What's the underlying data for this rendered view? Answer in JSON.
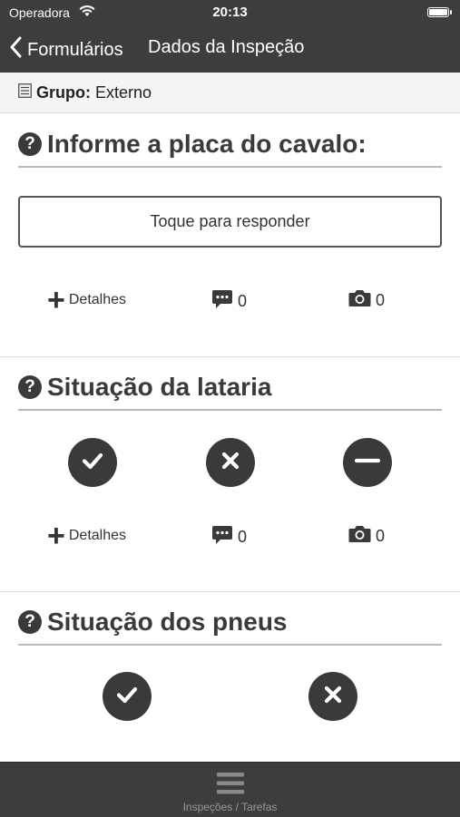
{
  "status_bar": {
    "carrier": "Operadora",
    "time": "20:13"
  },
  "nav": {
    "back_label": "Formulários",
    "title": "Dados da Inspeção"
  },
  "group": {
    "label": "Grupo:",
    "value": "Externo"
  },
  "questions": [
    {
      "title": "Informe a placa do cavalo:",
      "answer_placeholder": "Toque para responder",
      "details_label": "Detalhes",
      "comments_count": "0",
      "photos_count": "0"
    },
    {
      "title": "Situação da lataria",
      "options": [
        "check",
        "cross",
        "minus"
      ],
      "details_label": "Detalhes",
      "comments_count": "0",
      "photos_count": "0"
    },
    {
      "title": "Situação dos pneus",
      "options": [
        "check",
        "cross"
      ]
    }
  ],
  "tab_bar": {
    "label": "Inspeções / Tarefas",
    "icon": "menu-icon"
  },
  "colors": {
    "bar_bg": "#3d3d3d",
    "icon_dark": "#3a3a3a"
  }
}
